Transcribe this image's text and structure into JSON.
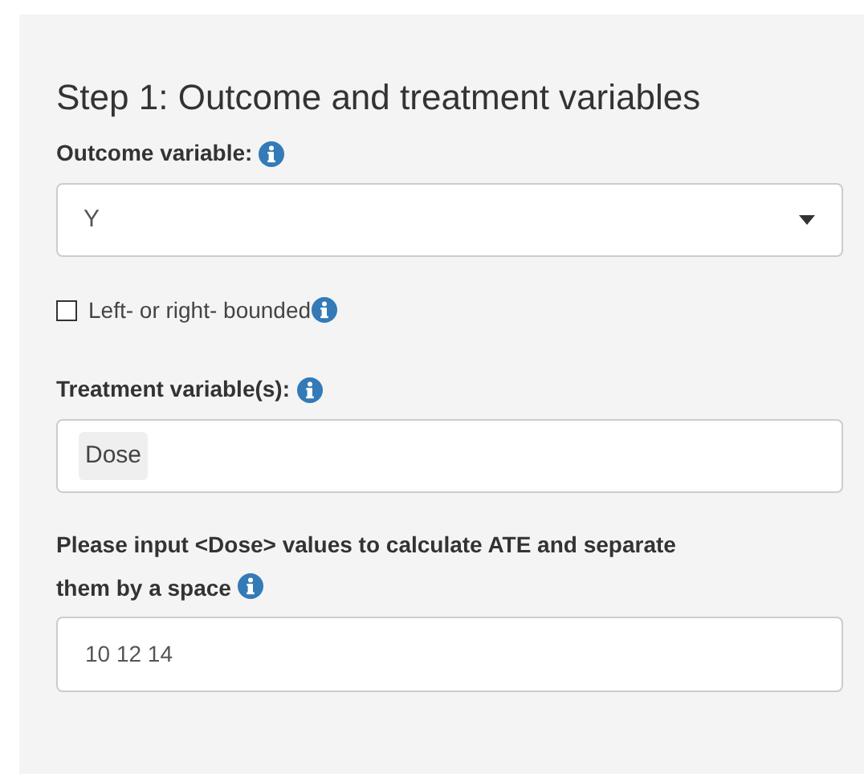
{
  "panel": {
    "title": "Step 1: Outcome and treatment variables"
  },
  "outcome": {
    "label": "Outcome variable:",
    "value": "Y"
  },
  "bounded": {
    "label": "Left- or right- bounded",
    "checked": false
  },
  "treatment": {
    "label": "Treatment variable(s):",
    "tags": [
      "Dose"
    ]
  },
  "values": {
    "label": "Please input <Dose> values to calculate ATE and separate them by a space",
    "value": "10 12 14"
  }
}
